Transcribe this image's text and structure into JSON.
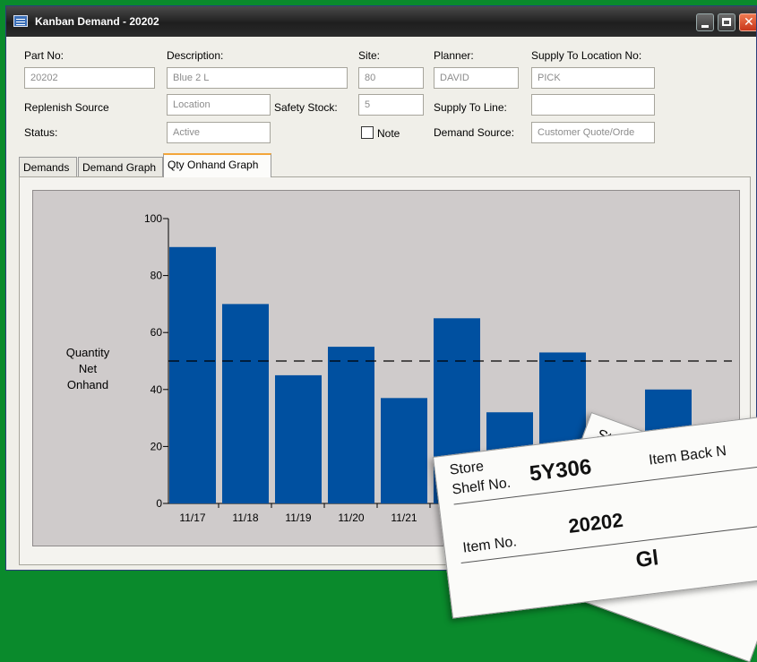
{
  "window": {
    "title": "Kanban Demand - 20202",
    "icon": "kanban-app-icon"
  },
  "form": {
    "part_no": {
      "label": "Part No:",
      "value": "20202"
    },
    "description": {
      "label": "Description:",
      "value": "Blue 2 L"
    },
    "site": {
      "label": "Site:",
      "value": "80"
    },
    "planner": {
      "label": "Planner:",
      "value": "DAVID"
    },
    "supply_to_location": {
      "label": "Supply To Location No:",
      "value": "PICK"
    },
    "replenish_source": {
      "label": "Replenish Source",
      "value": "Location"
    },
    "safety_stock": {
      "label": "Safety Stock:",
      "value": "5"
    },
    "supply_to_line": {
      "label": "Supply To Line:",
      "value": ""
    },
    "status": {
      "label": "Status:",
      "value": "Active"
    },
    "note": {
      "label": "Note",
      "checked": false
    },
    "demand_source": {
      "label": "Demand Source:",
      "value": "Customer Quote/Orde"
    }
  },
  "tabs": [
    {
      "label": "Demands",
      "active": false
    },
    {
      "label": "Demand Graph",
      "active": false
    },
    {
      "label": "Qty Onhand Graph",
      "active": true
    }
  ],
  "chart_data": {
    "type": "bar",
    "ylabel": "Quantity Net Onhand",
    "ylabel_lines": [
      "Quantity",
      "Net",
      "Onhand"
    ],
    "ylim": [
      0,
      100
    ],
    "yticks": [
      0,
      20,
      40,
      60,
      80,
      100
    ],
    "categories": [
      "11/17",
      "11/18",
      "11/19",
      "11/20",
      "11/21",
      "",
      "",
      "",
      "",
      "",
      ""
    ],
    "values": [
      90,
      70,
      45,
      55,
      37,
      65,
      32,
      53,
      null,
      40,
      null
    ],
    "reference_line": 50,
    "bar_color": "#0050a0"
  },
  "kanban_card": {
    "back_card_text": "St",
    "store_label": "Store",
    "shelf_label": "Shelf No.",
    "shelf_value": "5Y306",
    "item_back_label": "Item Back N",
    "item_no_label": "Item No.",
    "item_no_value": "20202",
    "partial_bottom": "Gl"
  }
}
